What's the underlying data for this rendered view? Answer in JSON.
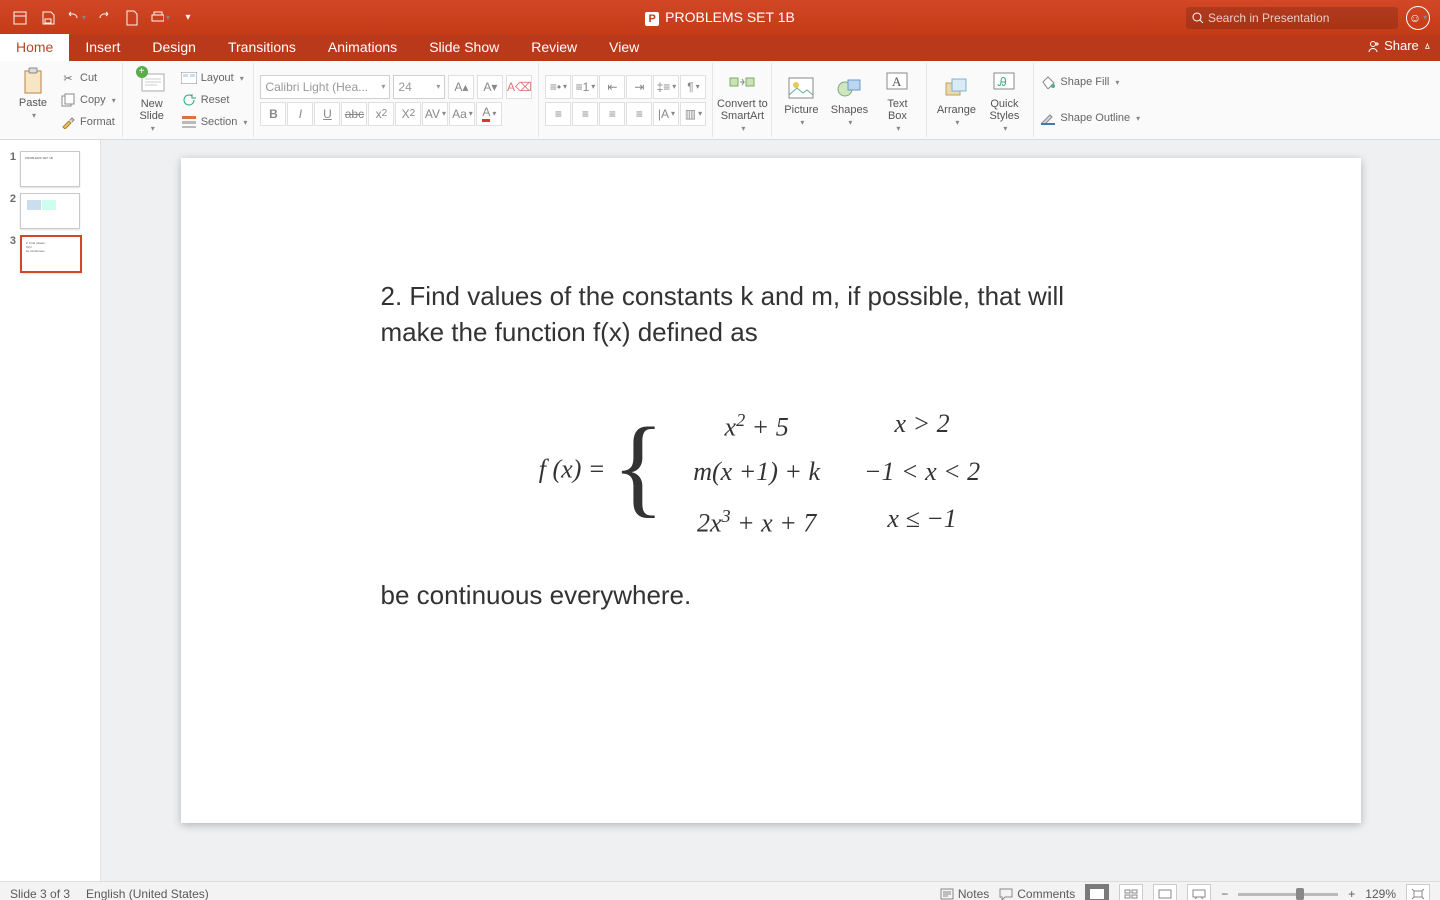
{
  "title": "PROBLEMS SET 1B",
  "search_placeholder": "Search in Presentation",
  "tabs": {
    "home": "Home",
    "insert": "Insert",
    "design": "Design",
    "transitions": "Transitions",
    "animations": "Animations",
    "slideshow": "Slide Show",
    "review": "Review",
    "view": "View"
  },
  "share_label": "Share",
  "ribbon": {
    "paste": "Paste",
    "cut": "Cut",
    "copy": "Copy",
    "format": "Format",
    "new_slide": "New\nSlide",
    "layout": "Layout",
    "reset": "Reset",
    "section": "Section",
    "font_name": "Calibri Light (Hea...",
    "font_size": "24",
    "convert": "Convert to\nSmartArt",
    "picture": "Picture",
    "shapes": "Shapes",
    "textbox": "Text\nBox",
    "arrange": "Arrange",
    "quick_styles": "Quick\nStyles",
    "shape_fill": "Shape Fill",
    "shape_outline": "Shape Outline"
  },
  "thumbs": {
    "n1": "1",
    "n2": "2",
    "n3": "3"
  },
  "slide": {
    "line1": "2. Find values of the constants  k  and  m, if possible, that will",
    "line2": "make the function  f(x) defined as",
    "fx": "f (x) =",
    "r1a": "x",
    "r1b": " + 5",
    "r1c": "x > 2",
    "r2a": "m(x +1) + k",
    "r2c": "−1 < x < 2",
    "r3a": "2x",
    "r3b": " + x + 7",
    "r3c": "x ≤ −1",
    "line3": "be continuous everywhere."
  },
  "status": {
    "slide": "Slide 3 of 3",
    "lang": "English (United States)",
    "notes": "Notes",
    "comments": "Comments",
    "zoom": "129%"
  }
}
